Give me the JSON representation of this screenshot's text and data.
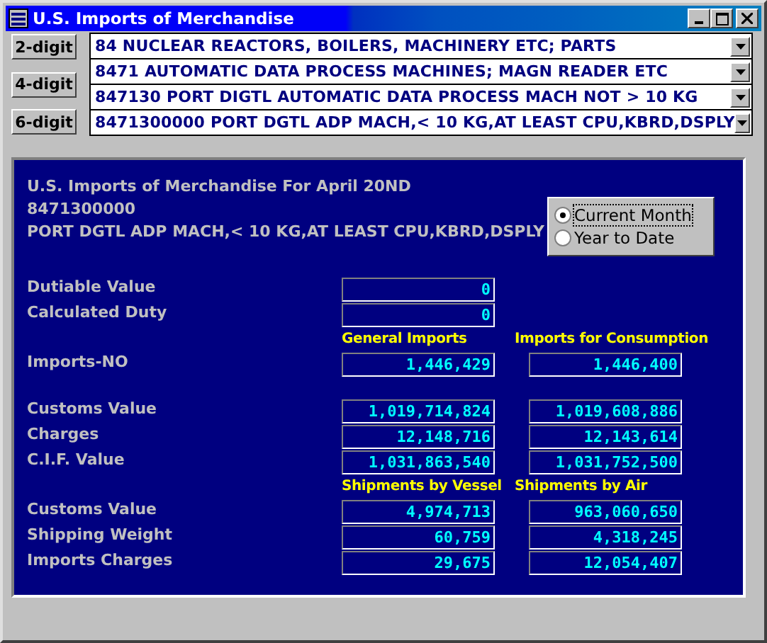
{
  "window": {
    "title": "U.S. Imports of Merchandise"
  },
  "digit_buttons": [
    "2-digit",
    "4-digit",
    "6-digit"
  ],
  "combos": [
    {
      "value": "84  NUCLEAR REACTORS, BOILERS, MACHINERY ETC; PARTS"
    },
    {
      "value": "8471  AUTOMATIC DATA PROCESS MACHINES; MAGN READER ETC"
    },
    {
      "value": "847130  PORT DIGTL AUTOMATIC DATA PROCESS MACH NOT > 10 KG"
    },
    {
      "value": "8471300000  PORT DGTL ADP MACH,< 10 KG,AT LEAST CPU,KBRD,DSPLY"
    }
  ],
  "report": {
    "heading": [
      "U.S. Imports of Merchandise For April 20ND",
      "8471300000",
      "PORT DGTL ADP MACH,< 10 KG,AT LEAST CPU,KBRD,DSPLY"
    ],
    "period": [
      {
        "label": "Current Month",
        "selected": true
      },
      {
        "label": "Year to Date",
        "selected": false
      }
    ],
    "groups": [
      {
        "rows": [
          {
            "label": "Dutiable Value",
            "values": [
              "0"
            ]
          },
          {
            "label": "Calculated Duty",
            "values": [
              "0"
            ]
          }
        ]
      },
      {
        "headings": [
          "General Imports",
          "Imports for Consumption"
        ],
        "rows": [
          {
            "label": "Imports-NO",
            "values": [
              "1,446,429",
              "1,446,400"
            ]
          }
        ]
      },
      {
        "rows": [
          {
            "label": "Customs Value",
            "values": [
              "1,019,714,824",
              "1,019,608,886"
            ]
          },
          {
            "label": "Charges",
            "values": [
              "12,148,716",
              "12,143,614"
            ]
          },
          {
            "label": "C.I.F. Value",
            "values": [
              "1,031,863,540",
              "1,031,752,500"
            ]
          }
        ]
      },
      {
        "headings": [
          "Shipments by Vessel",
          "Shipments by Air"
        ],
        "rows": [
          {
            "label": "Customs Value",
            "values": [
              "4,974,713",
              "963,060,650"
            ]
          },
          {
            "label": "Shipping Weight",
            "values": [
              "60,759",
              "4,318,245"
            ]
          },
          {
            "label": "Imports Charges",
            "values": [
              "29,675",
              "12,054,407"
            ]
          }
        ]
      }
    ]
  }
}
